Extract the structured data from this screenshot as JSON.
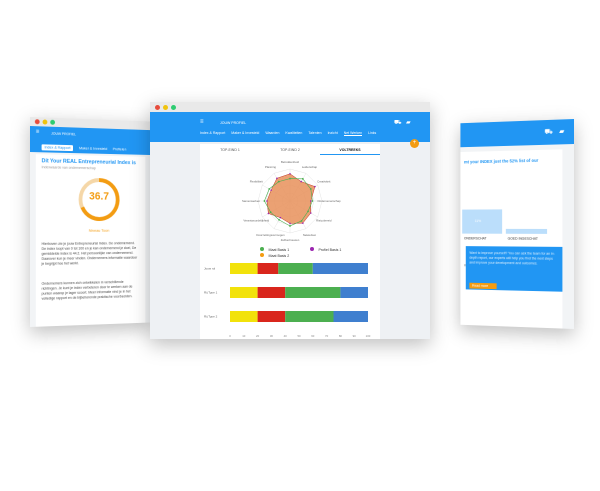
{
  "left": {
    "app_title": "JOUW PROFIEL",
    "tabs": [
      "Index & Rapport",
      "Maker & Investeld",
      "Profielen"
    ],
    "title": "Dit Your REAL Entrepreneurial Index is",
    "subtitle": "Indexwaarde van ondernemerschap",
    "score": "36.7",
    "score_label": "Niveau Toon",
    "paragraph1": "Hierboven zie je jouw Entrepreneurial Index. De ondernemend. De index loopt van 0 tot 100 en je kan ondernemend je doel, De gemiddelde index is 44.2. Het persoonlijke van ondernemend. Daarover kun je meer vinden. Ondernemers informatie waardoor je begrijpt hoe het werkt.",
    "paragraph2": "Ondernemers kunnen zich ontwikkelen in verschillende richtingen. Je kunt je index verbeteren door te werken aan de punten waarop je lager scoort. Meer informatie vind je in het volledige rapport en de bijbehorende praktische voorbeelden."
  },
  "middle": {
    "app_title": "JOUW PROFIEL",
    "nav": [
      "Index & Rapport",
      "Maker & Investeld",
      "Waarden",
      "Kwaliteiten",
      "Talenten",
      "Inzicht",
      "Net Werken",
      "Links"
    ],
    "active_nav": "Net Werken",
    "subtabs": [
      "TOP-EIND 1",
      "TOP-EIND 2",
      "VOLTREEKS"
    ],
    "active_subtab": "VOLTREEKS",
    "radar_labels": [
      "Betrokkenheid",
      "Leiderschap",
      "Creativiteit",
      "Ondernemerschap",
      "Risicobereid",
      "Netwerken",
      "Zelfvertrouwen",
      "Doorzettingsvermogen",
      "Verantwoordelijkheid",
      "Samenwerken",
      "Flexibiliteit",
      "Planning"
    ],
    "legend": [
      "Maat Basis 1",
      "Maat Basis 2",
      "Profiel Basis 1"
    ],
    "bar_labels": [
      "Jouw rol",
      "Rij Type 1",
      "Rij Type 2"
    ],
    "x_ticks": [
      "0",
      "10",
      "20",
      "30",
      "40",
      "50",
      "60",
      "70",
      "80",
      "90",
      "100"
    ],
    "fab_icon": "plus-icon"
  },
  "right": {
    "title": "mt your INDEX just the 52% list of our",
    "bar1_value": "11%",
    "bar_labels": [
      "ONDERSCHAT",
      "GOED INGESCHAT"
    ],
    "note": "mt your INDEX predictions state",
    "blue_text": "Want to improve yourself? You can ask the team for an in-depth report, our experts will help you find the next steps and improve your development and outcomes.",
    "button_label": "Read more"
  },
  "chart_data": {
    "type": "bar",
    "categories": [
      "Jouw rol",
      "Rij Type 1",
      "Rij Type 2"
    ],
    "series": [
      {
        "name": "yellow",
        "values": [
          20,
          20,
          20
        ]
      },
      {
        "name": "red",
        "values": [
          15,
          20,
          20
        ]
      },
      {
        "name": "green",
        "values": [
          25,
          40,
          35
        ]
      },
      {
        "name": "blue",
        "values": [
          40,
          20,
          25
        ]
      }
    ],
    "colors": [
      "#f2e20b",
      "#d9261c",
      "#4caf50",
      "#3f7fcf"
    ],
    "xlim": [
      0,
      100
    ]
  },
  "colors": {
    "primary": "#2196f3",
    "accent": "#f39c12",
    "radar_fill": "#e8915a"
  }
}
